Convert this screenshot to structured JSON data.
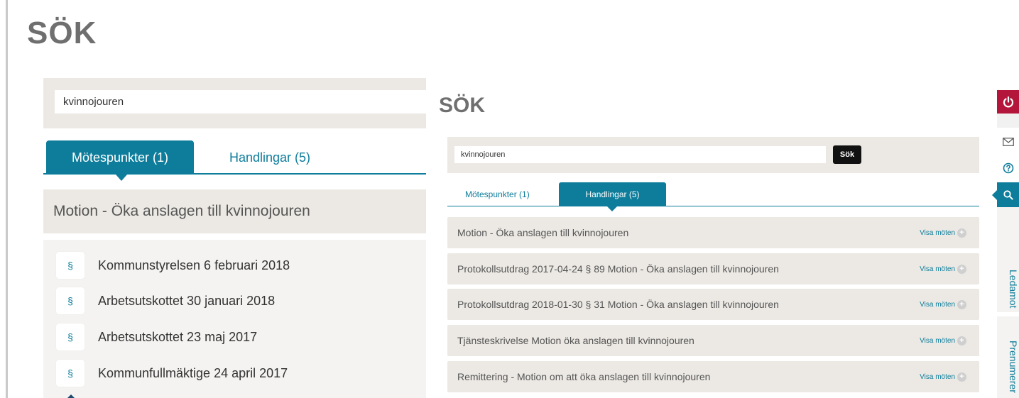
{
  "back_panel": {
    "title": "SÖK",
    "search": {
      "value": "kvinnojouren"
    },
    "tabs": [
      {
        "label": "Mötespunkter (1)",
        "active": true
      },
      {
        "label": "Handlingar (5)",
        "active": false
      }
    ],
    "result": {
      "title": "Motion - Öka anslagen till kvinnojouren",
      "meetings": [
        {
          "icon": "§",
          "label": "Kommunstyrelsen 6 februari 2018"
        },
        {
          "icon": "§",
          "label": "Arbetsutskottet 30 januari 2018"
        },
        {
          "icon": "§",
          "label": "Arbetsutskottet 23 maj 2017"
        },
        {
          "icon": "§",
          "label": "Kommunfullmäktige 24 april 2017"
        }
      ]
    }
  },
  "front_panel": {
    "title": "SÖK",
    "search": {
      "value": "kvinnojouren",
      "button_label": "Sök"
    },
    "tabs": [
      {
        "label": "Mötespunkter (1)",
        "active": false
      },
      {
        "label": "Handlingar (5)",
        "active": true
      }
    ],
    "documents": [
      {
        "title": "Motion - Öka anslagen till kvinnojouren",
        "link": "Visa möten"
      },
      {
        "title": "Protokollsutdrag 2017-04-24 § 89 Motion - Öka anslagen till kvinnojouren",
        "link": "Visa möten"
      },
      {
        "title": "Protokollsutdrag 2018-01-30 § 31 Motion - Öka anslagen till kvinnojouren",
        "link": "Visa möten"
      },
      {
        "title": "Tjänsteskrivelse Motion öka anslagen till kvinnojouren",
        "link": "Visa möten"
      },
      {
        "title": "Remittering - Motion om att öka anslagen till kvinnojouren",
        "link": "Visa möten"
      }
    ]
  },
  "sidebar": {
    "icons": [
      "power-icon",
      "mail-icon",
      "help-icon",
      "search-icon"
    ],
    "labels": [
      "Ledamot",
      "Prenumerer"
    ]
  },
  "colors": {
    "accent": "#0e7d9b",
    "power": "#b3163a",
    "panel_bg": "#ece9e4",
    "button_bg": "#111111"
  }
}
